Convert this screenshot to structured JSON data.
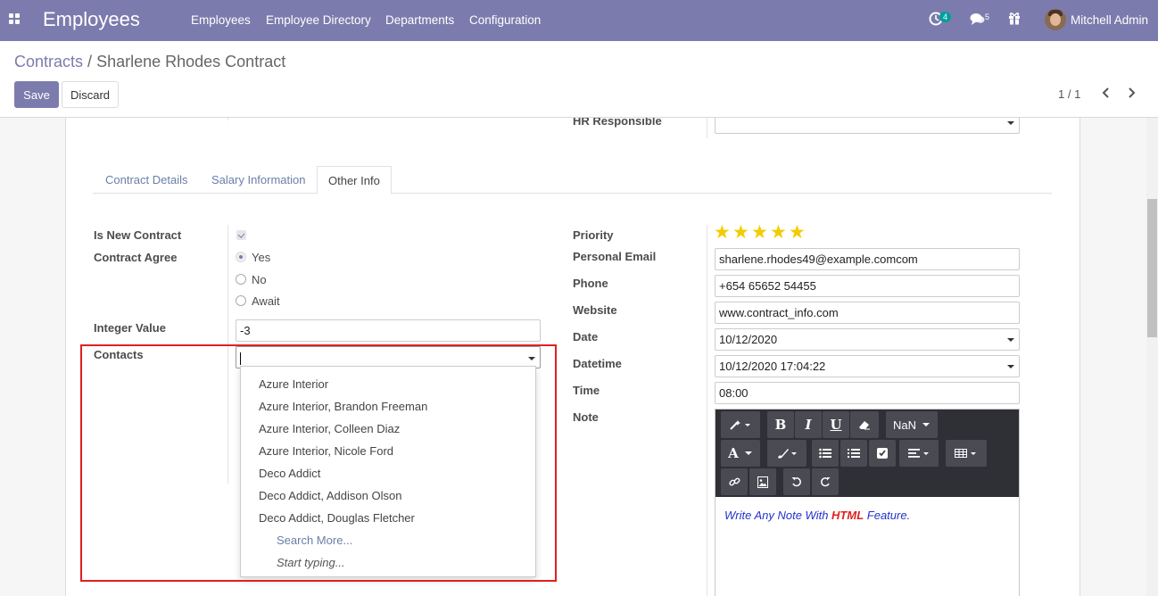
{
  "navbar": {
    "app_name": "Employees",
    "menu": [
      "Employees",
      "Employee Directory",
      "Departments",
      "Configuration"
    ],
    "activity_count": "4",
    "message_count": "5",
    "user_name": "Mitchell Admin"
  },
  "control": {
    "breadcrumb_parent": "Contracts",
    "breadcrumb_sep": "/",
    "breadcrumb_current": "Sharlene Rhodes Contract",
    "save_label": "Save",
    "discard_label": "Discard",
    "pager": "1 / 1"
  },
  "form": {
    "hr_responsible_label": "HR Responsible",
    "tabs": [
      "Contract Details",
      "Salary Information",
      "Other Info"
    ],
    "left": {
      "is_new_contract_label": "Is New Contract",
      "is_new_contract_checked": true,
      "contract_agree_label": "Contract Agree",
      "agree_options": [
        "Yes",
        "No",
        "Await"
      ],
      "agree_selected": "Yes",
      "integer_value_label": "Integer Value",
      "integer_value": "-3",
      "contacts_label": "Contacts",
      "contacts_value": ""
    },
    "right": {
      "priority_label": "Priority",
      "priority_stars": 5,
      "personal_email_label": "Personal Email",
      "personal_email": "sharlene.rhodes49@example.comcom",
      "phone_label": "Phone",
      "phone": "+654 65652 54455",
      "website_label": "Website",
      "website": "www.contract_info.com",
      "date_label": "Date",
      "date": "10/12/2020",
      "datetime_label": "Datetime",
      "datetime": "10/12/2020 17:04:22",
      "time_label": "Time",
      "time": "08:00",
      "note_label": "Note",
      "note_prefix": "Write Any Note With ",
      "note_html": "HTML",
      "note_suffix": " Feature.",
      "font_size_label": "NaN"
    }
  },
  "dropdown": {
    "items": [
      "Azure Interior",
      "Azure Interior, Brandon Freeman",
      "Azure Interior, Colleen Diaz",
      "Azure Interior, Nicole Ford",
      "Deco Addict",
      "Deco Addict, Addison Olson",
      "Deco Addict, Douglas Fletcher"
    ],
    "search_more": "Search More...",
    "start_typing": "Start typing..."
  },
  "colors": {
    "brand": "#7c7bad",
    "highlight_box": "#e02020",
    "star": "#f3cc00"
  }
}
